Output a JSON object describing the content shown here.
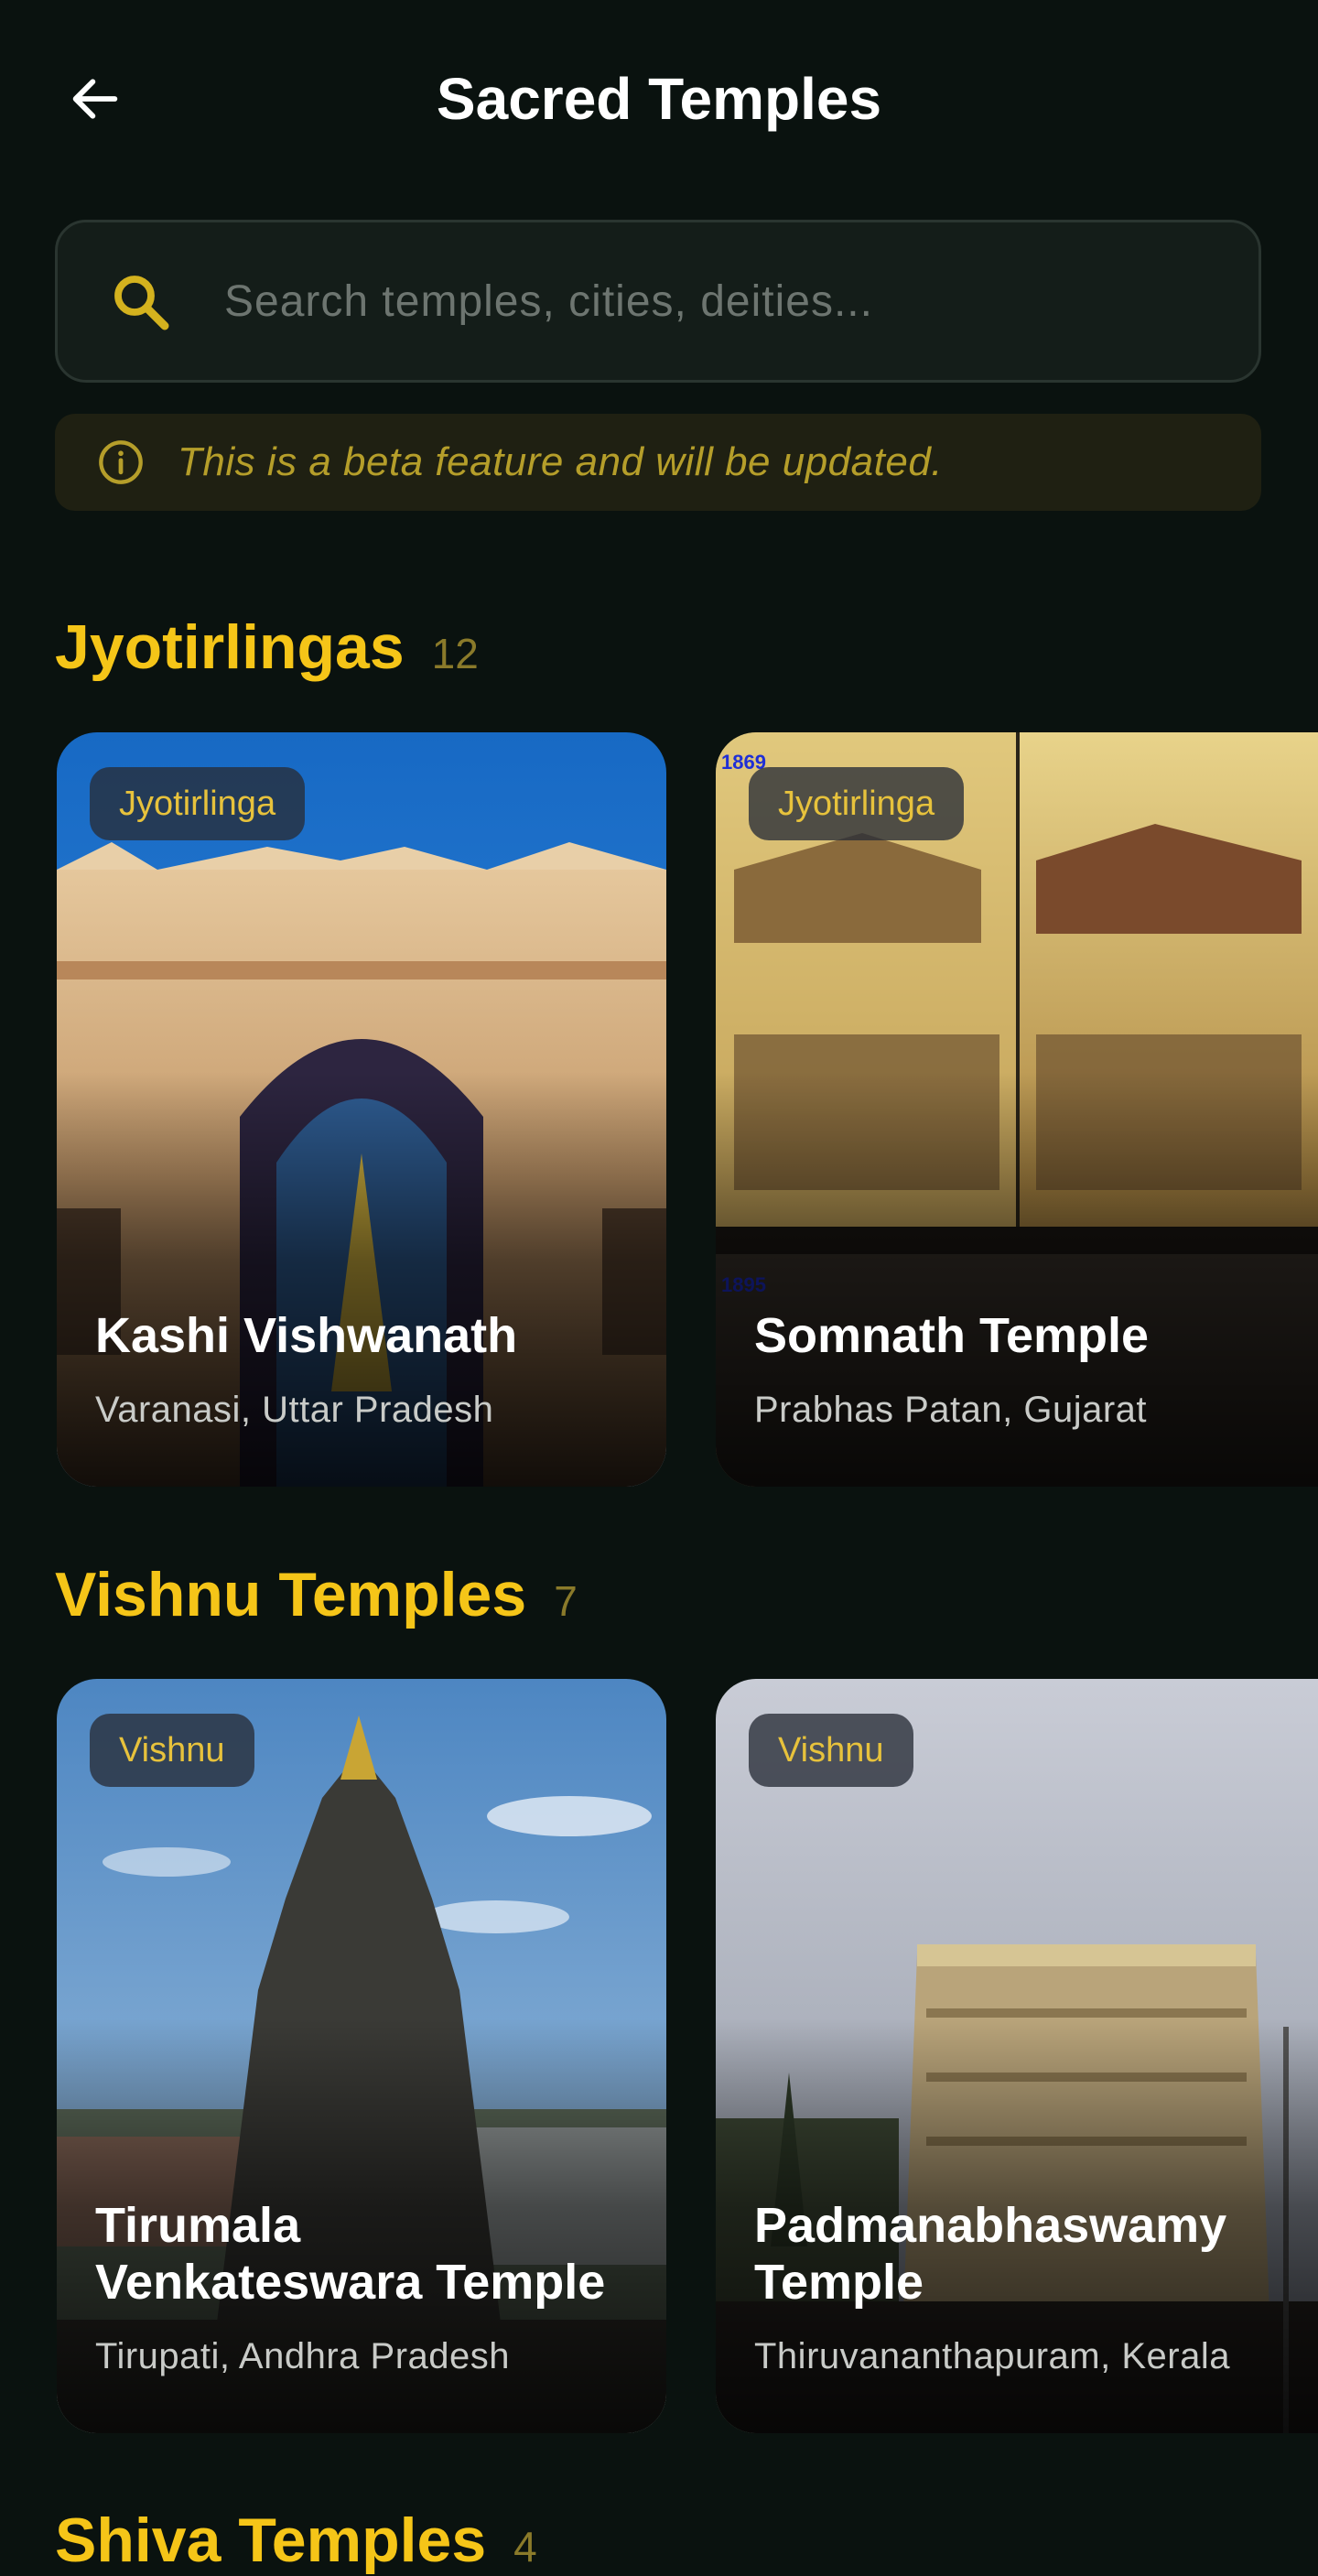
{
  "header": {
    "title": "Sacred Temples",
    "back_icon": "arrow-left-icon"
  },
  "search": {
    "placeholder": "Search temples, cities, deities...",
    "icon": "search-icon",
    "value": ""
  },
  "beta_notice": {
    "text": "This is a beta feature and will be updated.",
    "icon": "info-icon"
  },
  "sections": [
    {
      "title": "Jyotirlingas",
      "count": "12",
      "cards": [
        {
          "badge": "Jyotirlinga",
          "name": "Kashi Vishwanath",
          "location": "Varanasi, Uttar Pradesh"
        },
        {
          "badge": "Jyotirlinga",
          "name": "Somnath Temple",
          "location": "Prabhas Patan, Gujarat",
          "photo_labels": [
            "1869",
            "1895"
          ]
        }
      ]
    },
    {
      "title": "Vishnu Temples",
      "count": "7",
      "cards": [
        {
          "badge": "Vishnu",
          "name": "Tirumala Venkateswara Temple",
          "location": "Tirupati, Andhra Pradesh"
        },
        {
          "badge": "Vishnu",
          "name": "Padmanabhaswamy Temple",
          "location": "Thiruvananthapuram, Kerala"
        }
      ]
    },
    {
      "title": "Shiva Temples",
      "count": "4"
    }
  ],
  "colors": {
    "background": "#0a120f",
    "accent": "#f5c518",
    "badge_text": "#e7c23c",
    "beta_text": "#b59e2a"
  }
}
